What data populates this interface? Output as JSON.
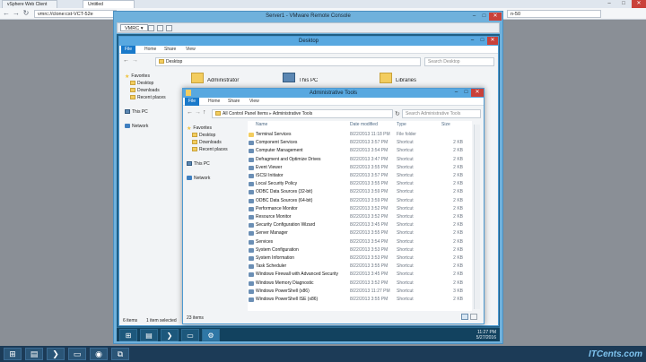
{
  "host": {
    "tabs": [
      "vSphere Web Client",
      "Untitled"
    ],
    "url": "vmrc://clone:cst-VCT-52e",
    "url_tail": "n-50",
    "window_controls": [
      "–",
      "□",
      "✕"
    ]
  },
  "vmrc": {
    "title": "Server1 - VMware Remote Console",
    "menu_label": "VMRC",
    "menu_arrow": "▾"
  },
  "desktop_window": {
    "title": "Desktop",
    "ribbon_tabs": [
      "File",
      "Home",
      "Share",
      "View"
    ],
    "address": "Desktop",
    "search_placeholder": "Search Desktop",
    "nav": {
      "favorites": "Favorites",
      "favorites_items": [
        "Desktop",
        "Downloads",
        "Recent places"
      ],
      "this_pc": "This PC",
      "network": "Network"
    },
    "icons": [
      "Administrator",
      "This PC",
      "Libraries"
    ],
    "status_items": "6 items",
    "status_selected": "1 item selected"
  },
  "admin_window": {
    "title": "Administrative Tools",
    "ribbon_tabs": [
      "File",
      "Home",
      "Share",
      "View"
    ],
    "address_parts": [
      "All Control Panel Items",
      "Administrative Tools"
    ],
    "search_placeholder": "Search Administrative Tools",
    "nav": {
      "favorites": "Favorites",
      "favorites_items": [
        "Desktop",
        "Downloads",
        "Recent places"
      ],
      "this_pc": "This PC",
      "network": "Network"
    },
    "columns": [
      "Name",
      "Date modified",
      "Type",
      "Size"
    ],
    "status": "23 items",
    "files": [
      {
        "name": "Terminal Services",
        "date": "8/22/2013 11:18 PM",
        "type": "File folder",
        "size": ""
      },
      {
        "name": "Component Services",
        "date": "8/22/2013 3:57 PM",
        "type": "Shortcut",
        "size": "2 KB"
      },
      {
        "name": "Computer Management",
        "date": "8/22/2013 3:54 PM",
        "type": "Shortcut",
        "size": "2 KB"
      },
      {
        "name": "Defragment and Optimize Drives",
        "date": "8/22/2013 3:47 PM",
        "type": "Shortcut",
        "size": "2 KB"
      },
      {
        "name": "Event Viewer",
        "date": "8/22/2013 3:55 PM",
        "type": "Shortcut",
        "size": "2 KB"
      },
      {
        "name": "iSCSI Initiator",
        "date": "8/22/2013 3:57 PM",
        "type": "Shortcut",
        "size": "2 KB"
      },
      {
        "name": "Local Security Policy",
        "date": "8/22/2013 3:55 PM",
        "type": "Shortcut",
        "size": "2 KB"
      },
      {
        "name": "ODBC Data Sources (32-bit)",
        "date": "8/22/2013 3:59 PM",
        "type": "Shortcut",
        "size": "2 KB"
      },
      {
        "name": "ODBC Data Sources (64-bit)",
        "date": "8/22/2013 3:59 PM",
        "type": "Shortcut",
        "size": "2 KB"
      },
      {
        "name": "Performance Monitor",
        "date": "8/22/2013 3:52 PM",
        "type": "Shortcut",
        "size": "2 KB"
      },
      {
        "name": "Resource Monitor",
        "date": "8/22/2013 3:52 PM",
        "type": "Shortcut",
        "size": "2 KB"
      },
      {
        "name": "Security Configuration Wizard",
        "date": "8/22/2013 3:45 PM",
        "type": "Shortcut",
        "size": "2 KB"
      },
      {
        "name": "Server Manager",
        "date": "8/22/2013 3:55 PM",
        "type": "Shortcut",
        "size": "2 KB"
      },
      {
        "name": "Services",
        "date": "8/22/2013 3:54 PM",
        "type": "Shortcut",
        "size": "2 KB"
      },
      {
        "name": "System Configuration",
        "date": "8/22/2013 3:53 PM",
        "type": "Shortcut",
        "size": "2 KB"
      },
      {
        "name": "System Information",
        "date": "8/22/2013 3:53 PM",
        "type": "Shortcut",
        "size": "2 KB"
      },
      {
        "name": "Task Scheduler",
        "date": "8/22/2013 3:55 PM",
        "type": "Shortcut",
        "size": "2 KB"
      },
      {
        "name": "Windows Firewall with Advanced Security",
        "date": "8/22/2013 3:45 PM",
        "type": "Shortcut",
        "size": "2 KB"
      },
      {
        "name": "Windows Memory Diagnostic",
        "date": "8/22/2013 3:52 PM",
        "type": "Shortcut",
        "size": "2 KB"
      },
      {
        "name": "Windows PowerShell (x86)",
        "date": "8/22/2013 11:27 PM",
        "type": "Shortcut",
        "size": "3 KB"
      },
      {
        "name": "Windows PowerShell ISE (x86)",
        "date": "8/22/2013 3:55 PM",
        "type": "Shortcut",
        "size": "2 KB"
      }
    ]
  },
  "guest_clock": {
    "time": "11:27 PM",
    "date": "5/27/2016"
  },
  "watermark": "ITCents.com",
  "colors": {
    "accent": "#1979ca",
    "title_bar": "#58a8e0",
    "desktop": "#1f5f86"
  }
}
